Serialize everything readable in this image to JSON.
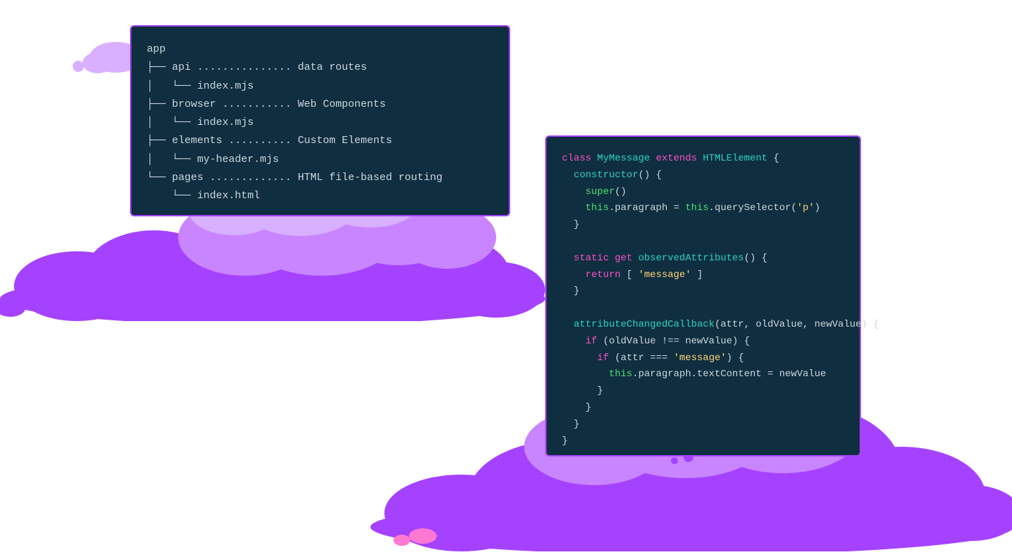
{
  "tree": {
    "l0": "app",
    "l1": "├── api ............... data routes",
    "l2": "│   └── index.mjs",
    "l3": "├── browser ........... Web Components",
    "l4": "│   └── index.mjs",
    "l5": "├── elements .......... Custom Elements",
    "l6": "│   └── my-header.mjs",
    "l7": "└── pages ............. HTML file-based routing",
    "l8": "    └── index.html"
  },
  "code": {
    "k_class": "class ",
    "cls_name": "MyMessage ",
    "k_extends": "extends ",
    "base_name": "HTMLElement ",
    "brace_open": "{",
    "ctor_sig": "  constructor() {",
    "ctor_name": "constructor",
    "super_indent": "    ",
    "super": "super",
    "super_paren": "()",
    "assign_indent": "    ",
    "this": "this",
    "dot_para_eq": ".paragraph = ",
    "dot_qs": ".querySelector(",
    "str_p": "'p'",
    "close_paren": ")",
    "close_ctor": "  }",
    "blank": "",
    "static_get": "  static get ",
    "static": "static ",
    "get": "get ",
    "obs_attr": "observedAttributes",
    "obs_sig_end": "() {",
    "return_indent": "    ",
    "return": "return ",
    "arr_open": "[ ",
    "str_msg": "'message'",
    "arr_close": " ]",
    "close_obs": "  }",
    "acc_name": "attributeChangedCallback",
    "acc_indent": "  ",
    "acc_args": "(attr, oldValue, newValue) {",
    "if1_indent": "    ",
    "if": "if ",
    "if1_cond": "(oldValue !== newValue) {",
    "if2_indent": "      ",
    "if2_cond_open": "(attr === ",
    "if2_cond_close": ") {",
    "set_indent": "        ",
    "set_rest": ".paragraph.textContent = newValue",
    "close_if2": "      }",
    "close_if1": "    }",
    "close_acc": "  }",
    "close_class": "}"
  },
  "colors": {
    "panel_bg": "#0f2e3f",
    "panel_border": "#a542ff",
    "cloud_dark": "#a542ff",
    "cloud_mid": "#c985ff",
    "cloud_light": "#d9afff",
    "pink": "#ff78d2"
  }
}
